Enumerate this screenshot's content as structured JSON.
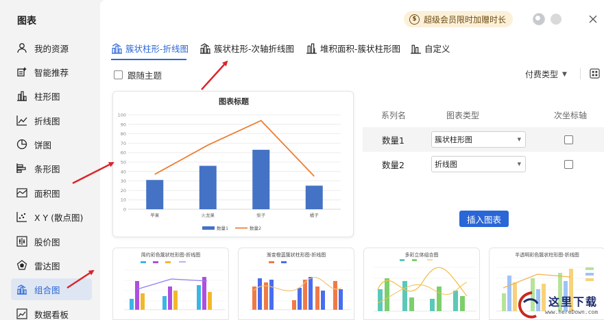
{
  "sidebar": {
    "title": "图表",
    "items": [
      {
        "label": "我的资源",
        "icon": "user-icon"
      },
      {
        "label": "智能推荐",
        "icon": "smart-recommend-icon"
      },
      {
        "label": "柱形图",
        "icon": "column-chart-icon"
      },
      {
        "label": "折线图",
        "icon": "line-chart-icon"
      },
      {
        "label": "饼图",
        "icon": "pie-chart-icon"
      },
      {
        "label": "条形图",
        "icon": "bar-chart-icon"
      },
      {
        "label": "面积图",
        "icon": "area-chart-icon"
      },
      {
        "label": "X Y (散点图)",
        "icon": "scatter-chart-icon"
      },
      {
        "label": "股价图",
        "icon": "stock-chart-icon"
      },
      {
        "label": "雷达图",
        "icon": "radar-chart-icon"
      },
      {
        "label": "组合图",
        "icon": "combo-chart-icon",
        "active": true
      },
      {
        "label": "数据看板",
        "icon": "dashboard-icon"
      }
    ]
  },
  "header": {
    "vip_label": "超级会员限时加赠时长",
    "vip_icon": "coin-icon"
  },
  "tabs": [
    {
      "label": "簇状柱形-折线图",
      "active": true
    },
    {
      "label": "簇状柱形-次轴折线图"
    },
    {
      "label": "堆积面积-簇状柱形图"
    },
    {
      "label": "自定义"
    }
  ],
  "options": {
    "follow_theme_label": "跟随主题",
    "paid_type_label": "付费类型"
  },
  "series_table": {
    "headers": [
      "系列名",
      "图表类型",
      "次坐标轴"
    ],
    "rows": [
      {
        "name": "数量1",
        "type": "簇状柱形图",
        "secondary": false
      },
      {
        "name": "数量2",
        "type": "折线图",
        "secondary": false
      }
    ]
  },
  "insert_button": "插入图表",
  "chart_data": {
    "type": "bar",
    "title": "图表标题",
    "categories": [
      "苹果",
      "火龙果",
      "梨子",
      "橘子"
    ],
    "series": [
      {
        "name": "数量1",
        "type": "bar",
        "color": "#4472c4",
        "values": [
          31,
          46,
          63,
          25
        ]
      },
      {
        "name": "数量2",
        "type": "line",
        "color": "#ed7d31",
        "values": [
          37,
          68,
          94,
          35
        ]
      }
    ],
    "yticks": [
      "0",
      "10",
      "20",
      "30",
      "40",
      "50",
      "60",
      "70",
      "80",
      "90",
      "100"
    ],
    "ylim": [
      0,
      100
    ],
    "grid": true,
    "legend_position": "bottom"
  },
  "thumbnails": [
    {
      "title": "简约彩色簇状柱形图-折线图"
    },
    {
      "title": "渐变橙蓝簇状柱形图-折线图"
    },
    {
      "title": "多彩立体组合图"
    },
    {
      "title": "半透明彩色簇状柱形图-折线图"
    }
  ],
  "watermark": {
    "text": "这里下载",
    "url": "www.hereDown.com"
  },
  "colors": {
    "accent": "#2a66d6",
    "annotation_arrow": "#d9262b",
    "bar": "#4472c4",
    "line": "#ed7d31"
  }
}
